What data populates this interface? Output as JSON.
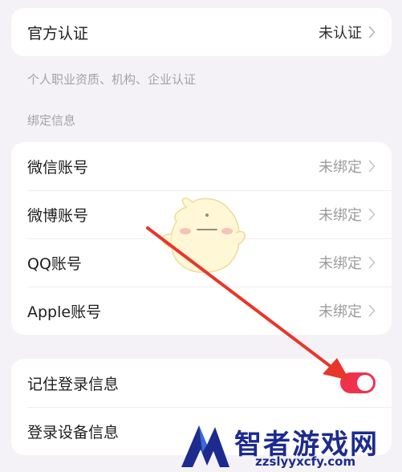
{
  "official": {
    "label": "官方认证",
    "value": "未认证",
    "note": "个人职业资质、机构、企业认证"
  },
  "binding": {
    "section_title": "绑定信息",
    "items": [
      {
        "label": "微信账号",
        "value": "未绑定"
      },
      {
        "label": "微博账号",
        "value": "未绑定"
      },
      {
        "label": "QQ账号",
        "value": "未绑定"
      },
      {
        "label": "Apple账号",
        "value": "未绑定"
      }
    ]
  },
  "login": {
    "remember_label": "记住登录信息",
    "remember_on": true,
    "devices_label": "登录设备信息"
  },
  "watermark": {
    "name": "智者游戏网",
    "domain": "zzslyyxcfy.com"
  },
  "colors": {
    "toggle_on": "#f0314e",
    "annotation_arrow": "#e8362a"
  },
  "icons": {
    "chevron": "chevron-right-icon",
    "mascot": "mascot-sticker",
    "watermark_logo": "watermark-logo"
  }
}
